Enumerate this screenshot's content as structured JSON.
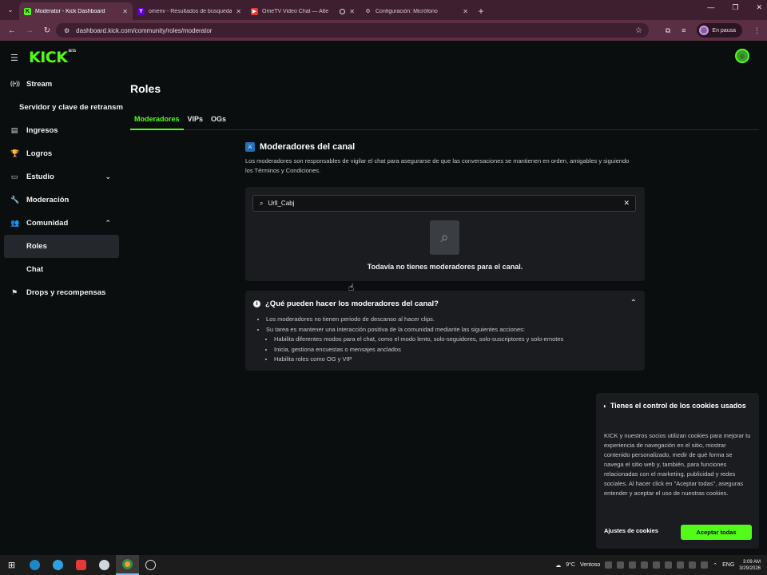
{
  "browser": {
    "tabs": [
      {
        "title": "Moderator - Kick Dashboard",
        "favicon": "K",
        "color": "#53fc18",
        "active": true
      },
      {
        "title": "omeriv - Resultados de búsqueda",
        "favicon": "Y",
        "color": "#6001d2",
        "active": false
      },
      {
        "title": "OmeTV Video Chat — Alte",
        "favicon": "▶",
        "color": "#e53935",
        "active": false
      },
      {
        "title": "Configuración: Micrófono",
        "favicon": "⚙",
        "color": "#9aa0a6",
        "active": false
      }
    ],
    "url": "dashboard.kick.com/community/roles/moderator",
    "profile_label": "En pausa"
  },
  "app": {
    "logo": "KICK",
    "logo_badge": "BETA",
    "sidebar": {
      "items": [
        {
          "label": "Stream",
          "icon": "broadcast-icon",
          "glyph": "((•))"
        },
        {
          "label": "Servidor y clave de retransm",
          "sub": true
        },
        {
          "label": "Ingresos",
          "icon": "chart-icon",
          "glyph": "▤"
        },
        {
          "label": "Logros",
          "icon": "trophy-icon",
          "glyph": "🏆"
        },
        {
          "label": "Estudio",
          "icon": "studio-icon",
          "glyph": "▭",
          "chevron": "down"
        },
        {
          "label": "Moderación",
          "icon": "wrench-icon",
          "glyph": "🔧"
        },
        {
          "label": "Comunidad",
          "icon": "community-icon",
          "glyph": "👥",
          "chevron": "up"
        },
        {
          "label": "Roles",
          "sub": true,
          "selected": true
        },
        {
          "label": "Chat",
          "sub": true
        },
        {
          "label": "Drops y recompensas",
          "icon": "drops-icon",
          "glyph": "⚑"
        }
      ]
    },
    "page_title": "Roles",
    "tabs": [
      {
        "label": "Moderadores",
        "active": true
      },
      {
        "label": "VIPs",
        "active": false
      },
      {
        "label": "OGs",
        "active": false
      }
    ],
    "section": {
      "title": "Moderadores del canal",
      "description": "Los moderadores son responsables de vigilar el chat para asegurarse de que las conversaciones se mantienen en orden, amigables y siguiendo los Términos y Condiciones."
    },
    "search": {
      "value": "Urll_Cabj"
    },
    "empty_message": "Todavía no tienes moderadores para el canal.",
    "faq": {
      "title": "¿Qué pueden hacer los moderadores del canal?",
      "bullets": [
        "Los moderadores no tienen periodo de descanso al hacer clips.",
        "Su tarea es mantener una interacción positiva de la comunidad mediante las siguientes acciones:"
      ],
      "sub_bullets": [
        "Habilita diferentes modos para el chat, como el modo lento, solo-seguidores, solo-suscriptores y solo-emotes",
        "Inicia, gestiona encuestas o mensajes anclados",
        "Habilita roles como OG y VIP"
      ]
    },
    "cookie": {
      "title": "Tienes el control de los cookies usados",
      "body": "KICK y nuestros socios utilizan cookies para mejorar tu experiencia de navegación en el sitio, mostrar contenido personalizado, medir de qué forma se navega el sitio web y, también, para funciones relacionadas con el marketing, publicidad y redes sociales. Al hacer click en \"Aceptar todas\", aseguras entender y aceptar el uso de nuestras cookies.",
      "settings_label": "Ajustes de cookies",
      "accept_label": "Aceptar todas"
    }
  },
  "taskbar": {
    "weather": "9°C",
    "weather_text": "Ventoso",
    "lang": "ENG",
    "time": "3:09 AM",
    "date": "3/29/2026"
  },
  "colors": {
    "accent": "#53fc18",
    "browser_frame": "#5a2f44",
    "panel": "#1a1c1f"
  }
}
